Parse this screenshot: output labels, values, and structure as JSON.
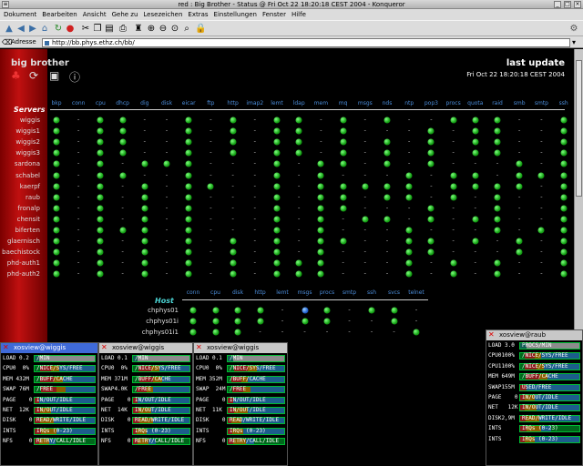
{
  "window": {
    "title": "red : Big Brother - Status @ Fri Oct 22 18:20:18 CEST 2004 - Konqueror"
  },
  "menu": [
    "Dokument",
    "Bearbeiten",
    "Ansicht",
    "Gehe zu",
    "Lesezeichen",
    "Extras",
    "Einstellungen",
    "Fenster",
    "Hilfe"
  ],
  "location": {
    "label": "Adresse",
    "url": "http://bb.phys.ethz.ch/bb/"
  },
  "page": {
    "brand": "big brother",
    "last_update_label": "last update",
    "timestamp": "Fri Oct 22 18:20:18 CEST 2004",
    "servers_label": "Servers",
    "host_label": "Host"
  },
  "columns": [
    "bkp",
    "conn",
    "cpu",
    "dhcp",
    "dig",
    "disk",
    "eicar",
    "ftp",
    "http",
    "imap2",
    "lemt",
    "ldap",
    "mem",
    "mq",
    "msgs",
    "nds",
    "ntp",
    "pop3",
    "procs",
    "quota",
    "raid",
    "smb",
    "smtp",
    "ssh"
  ],
  "servers": [
    {
      "name": "wiggis",
      "s": "g-gg--g-g-gg-g-g--ggg--g"
    },
    {
      "name": "wiggis1",
      "s": "g-gg--g-g-gg-g---g-gg--g"
    },
    {
      "name": "wiggis2",
      "s": "g-gg--g-g-gg-g-g-g-gg--g"
    },
    {
      "name": "wiggis3",
      "s": "g-gg--g-g-gg-g-g-g-gg--g"
    },
    {
      "name": "sardona",
      "s": "g-g-ggg---g-gg-g-g---g-g"
    },
    {
      "name": "schabel",
      "s": "g-gg--g---g-g---g-gg-ggg"
    },
    {
      "name": "kaerpf",
      "s": "g-g-g-gg--g-ggggg-gggg-g"
    },
    {
      "name": "raub",
      "s": "g-g-g-g---g-gg-gg-g-g--g"
    },
    {
      "name": "fronalp",
      "s": "g-g-g-g---g-gg---g--g--g"
    },
    {
      "name": "chensit",
      "s": "g-g-g-g---g-g-gg-g-gg--g"
    },
    {
      "name": "biferten",
      "s": "g-ggg-g---g-g---g---g-gg"
    },
    {
      "name": "glaernisch",
      "s": "g-g-g-g-g-g-gg--gg-g-g-g"
    },
    {
      "name": "baechistock",
      "s": "g-g-g-g-g-g-g---gg---g-g"
    },
    {
      "name": "phd-auth1",
      "s": "g-g-g-g-g-ggg---g-g-g--g"
    },
    {
      "name": "phd-auth2",
      "s": "g-g-g-g-g-ggg---g-g-g--g"
    }
  ],
  "host_columns": [
    "conn",
    "cpu",
    "disk",
    "http",
    "lemt",
    "msgs",
    "procs",
    "smtp",
    "ssh",
    "svcs",
    "telnet"
  ],
  "hosts": [
    {
      "name": "chphys01",
      "s": "gggg-bg-gg-"
    },
    {
      "name": "chphys01i",
      "s": "gggg-gg--g-"
    },
    {
      "name": "chphys01i1",
      "s": "ggg-------g"
    }
  ],
  "xosview": [
    {
      "title": "xosview@wiggis",
      "rows": [
        [
          "LOAD 0.2",
          "/MIN"
        ],
        [
          "CPU0  0%",
          "/NICE/SYS/FREE"
        ],
        [
          "MEM 432M",
          "/BUFF/CACHE"
        ],
        [
          "SWAP 76M",
          "/FREE"
        ],
        [
          "PAGE    0",
          "IN/OUT/IDLE"
        ],
        [
          "NET  12K",
          "IN/OUT/IDLE"
        ],
        [
          "DISK    0",
          "READ/WRITE/IDLE"
        ],
        [
          "INTS",
          "IRQs (0-23)"
        ],
        [
          "NFS     0",
          "RETRY/CALL/IDLE"
        ]
      ]
    },
    {
      "title": "xosview@wiggis",
      "rows": [
        [
          "LOAD 0.1",
          "/MIN"
        ],
        [
          "CPU0  0%",
          "/NICE/SYS/FREE"
        ],
        [
          "MEM 371M",
          "/BUFF/CACHE"
        ],
        [
          "SWAP4.0K",
          "/FREE"
        ],
        [
          "PAGE    0",
          "IN/OUT/IDLE"
        ],
        [
          "NET  14K",
          "IN/OUT/IDLE"
        ],
        [
          "DISK    0",
          "READ/WRITE/IDLE"
        ],
        [
          "INTS",
          "IRQs (0-23)"
        ],
        [
          "NFS     0",
          "RETRY/CALL/IDLE"
        ]
      ]
    },
    {
      "title": "xosview@wiggis",
      "rows": [
        [
          "LOAD 0.1",
          "/MIN"
        ],
        [
          "CPU0  0%",
          "/NICE/SYS/FREE"
        ],
        [
          "MEM 352M",
          "/BUFF/CACHE"
        ],
        [
          "SWAP  24M",
          "/FREE"
        ],
        [
          "PAGE    0",
          "IN/OUT/IDLE"
        ],
        [
          "NET  11K",
          "IN/OUT/IDLE"
        ],
        [
          "DISK    0",
          "READ/WRITE/IDLE"
        ],
        [
          "INTS",
          "IRQs (0-23)"
        ],
        [
          "NFS     0",
          "RETRY/CALL/IDLE"
        ]
      ]
    },
    {
      "title": "xosview@raub",
      "rows": [
        [
          "LOAD 3.0",
          "PROCS/MIN"
        ],
        [
          "CPU0100%",
          "/NICE/SYS/FREE"
        ],
        [
          "CPU1100%",
          "/NICE/SYS/FREE"
        ],
        [
          "MEM 649M",
          "/BUFF/CACHE"
        ],
        [
          "SWAP155M",
          "USED/FREE"
        ],
        [
          "PAGE    0",
          "IN/OUT/IDLE"
        ],
        [
          "NET   12K",
          "IN/OUT/IDLE"
        ],
        [
          "DISK2,9M",
          "READ/WRITE/IDLE"
        ],
        [
          "INTS",
          "IRQs (0-23)"
        ],
        [
          "INTS",
          "IRQs (0-23)"
        ]
      ]
    }
  ]
}
